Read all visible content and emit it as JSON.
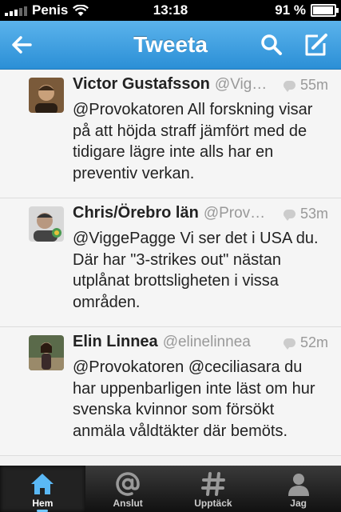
{
  "status": {
    "carrier": "Penis",
    "time": "13:18",
    "battery": "91 %",
    "battery_level": 0.91
  },
  "nav": {
    "title": "Tweeta"
  },
  "tweets": [
    {
      "name": "Victor Gustafsson",
      "handle": "@Vig…",
      "time": "55m",
      "text": "@Provokatoren All forskning visar på att höjda straff jämfört med de tidigare lägre inte alls har en preventiv verkan."
    },
    {
      "name": "Chris/Örebro län",
      "handle": "@Prov…",
      "time": "53m",
      "text": "@ViggePagge Vi ser det i USA du. Där har \"3-strikes out\" nästan utplånat brottsligheten i vissa områden."
    },
    {
      "name": "Elin Linnea",
      "handle": "@elinelinnea",
      "time": "52m",
      "text": "@Provokatoren @ceciliasara du har uppenbarligen inte läst om hur svenska kvinnor som försökt anmäla våldtäkter där bemöts."
    }
  ],
  "tabs": [
    {
      "label": "Hem",
      "icon": "home-icon"
    },
    {
      "label": "Anslut",
      "icon": "at-icon"
    },
    {
      "label": "Upptäck",
      "icon": "hash-icon"
    },
    {
      "label": "Jag",
      "icon": "person-icon"
    }
  ]
}
